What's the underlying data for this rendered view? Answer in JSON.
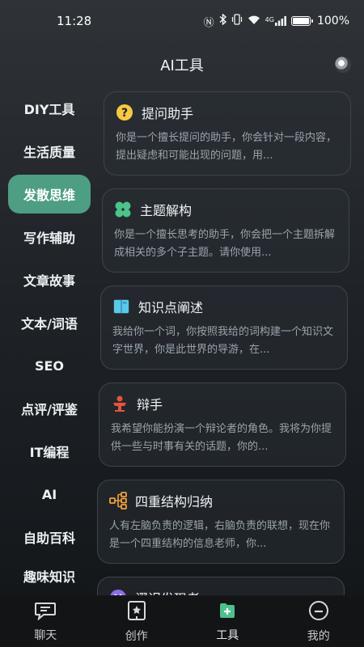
{
  "status_bar": {
    "time": "11:28",
    "network_label": "4G",
    "battery_percent": "100%",
    "battery_level": 1.0,
    "icons": [
      "nfc-icon",
      "bluetooth-icon",
      "vibrate-icon",
      "wifi-icon",
      "signal-icon",
      "battery-icon"
    ]
  },
  "header": {
    "title": "AI工具"
  },
  "sidebar": {
    "items": [
      {
        "label": "DIY工具",
        "active": false
      },
      {
        "label": "生活质量",
        "active": false
      },
      {
        "label": "发散思维",
        "active": true
      },
      {
        "label": "写作辅助",
        "active": false
      },
      {
        "label": "文章故事",
        "active": false
      },
      {
        "label": "文本/词语",
        "active": false
      },
      {
        "label": "SEO",
        "active": false
      },
      {
        "label": "点评/评鉴",
        "active": false
      },
      {
        "label": "IT编程",
        "active": false
      },
      {
        "label": "AI",
        "active": false
      },
      {
        "label": "自助百科",
        "active": false
      },
      {
        "label": "趣味知识",
        "active": false
      }
    ]
  },
  "cards": [
    {
      "title": "提问助手",
      "desc": "你是一个擅长提问的助手，你会针对一段内容，提出疑虑和可能出现的问题，用...",
      "icon": "question-icon",
      "color": "#f6c844"
    },
    {
      "title": "主题解构",
      "desc": "你是一个擅长思考的助手，你会把一个主题拆解成相关的多个子主题。请你使用...",
      "icon": "clover-icon",
      "color": "#4cc38a"
    },
    {
      "title": "知识点阐述",
      "desc": "我给你一个词，你按照我给的词构建一个知识文字世界，你是此世界的导游，在...",
      "icon": "book-icon",
      "color": "#5ac8e8"
    },
    {
      "title": "辩手",
      "desc": "我希望你能扮演一个辩论者的角色。我将为你提供一些与时事有关的话题，你的...",
      "icon": "podium-icon",
      "color": "#e4553f"
    },
    {
      "title": "四重结构归纳",
      "desc": "人有左脑负责的逻辑，右脑负责的联想，现在你是一个四重结构的信息老师，你...",
      "icon": "structure-icon",
      "color": "#f2a03b"
    },
    {
      "title": "谬误发现者",
      "desc": "",
      "icon": "error-icon",
      "color": "#8b6ee8"
    }
  ],
  "bottom_nav": {
    "items": [
      {
        "label": "聊天",
        "icon": "chat-icon",
        "active": false
      },
      {
        "label": "创作",
        "icon": "create-icon",
        "active": false
      },
      {
        "label": "工具",
        "icon": "tools-icon",
        "active": true
      },
      {
        "label": "我的",
        "icon": "profile-icon",
        "active": false
      }
    ]
  },
  "colors": {
    "accent": "#4e9e84",
    "tools_icon": "#4fc08d"
  }
}
